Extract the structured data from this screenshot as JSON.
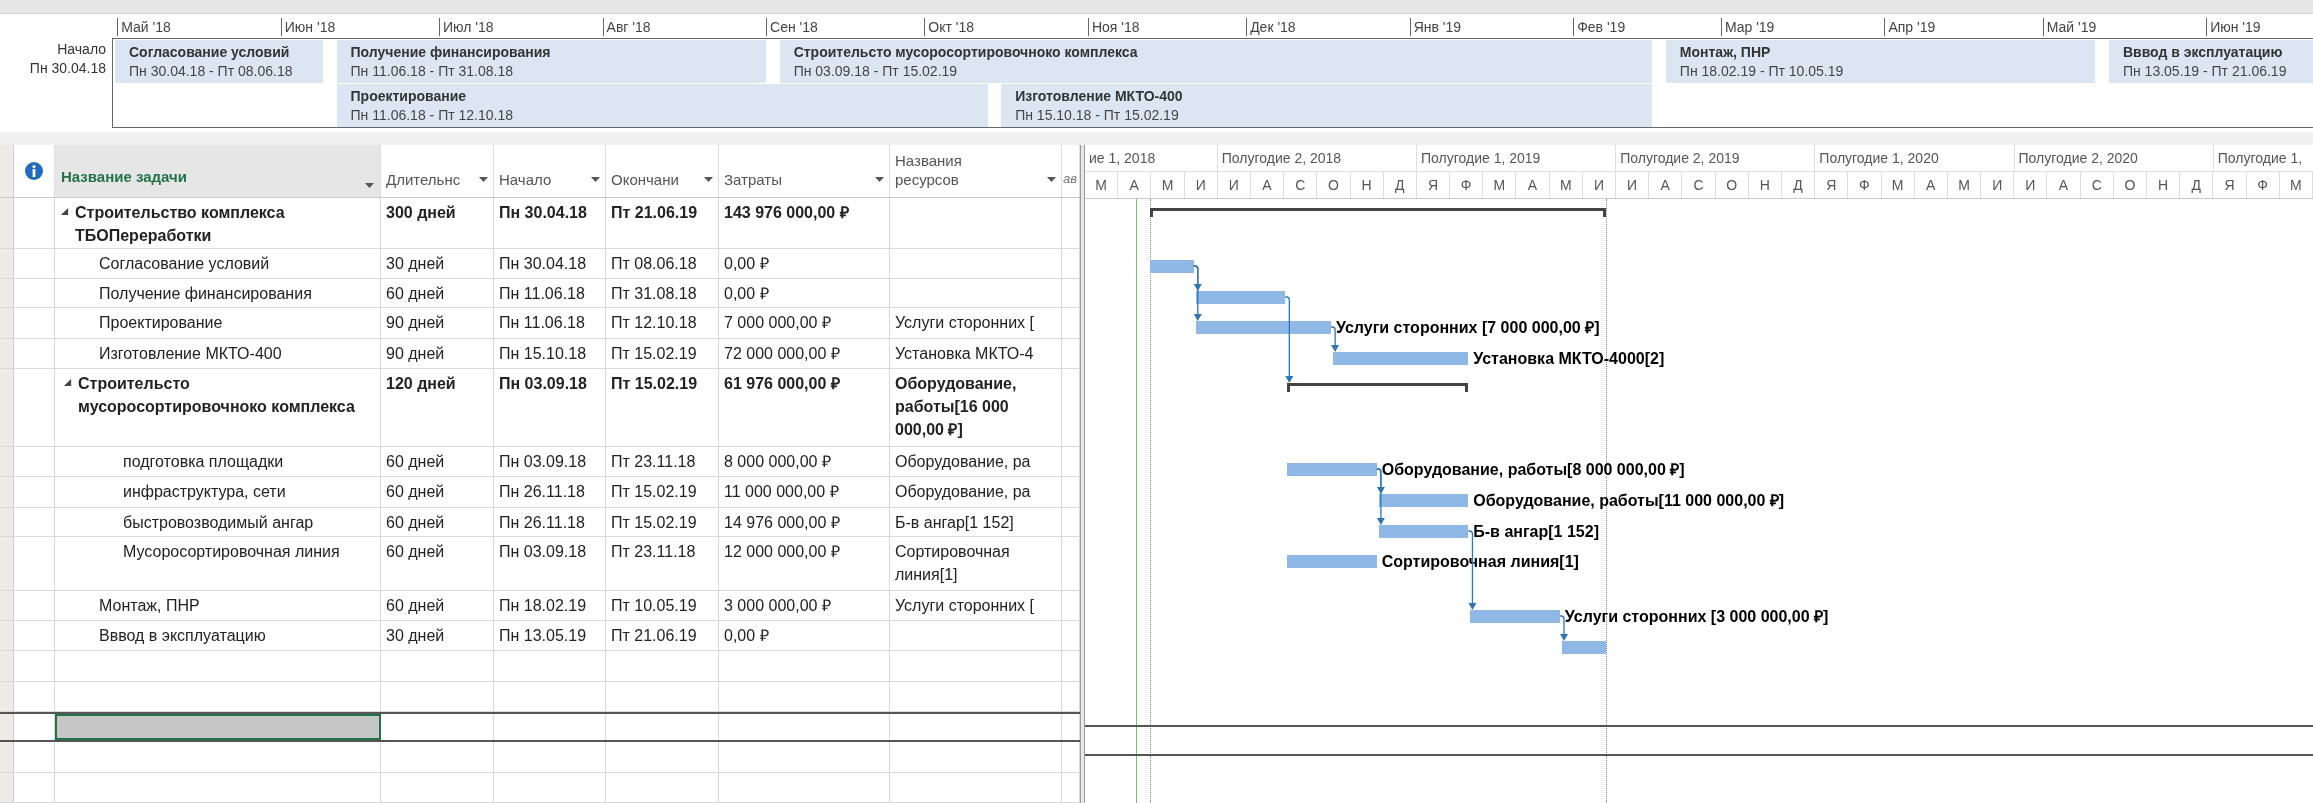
{
  "timeline": {
    "start_label": "Начало",
    "start_date": "Пн 30.04.18",
    "months": [
      "Май '18",
      "Июн '18",
      "Июл '18",
      "Авг '18",
      "Сен '18",
      "Окт '18",
      "Ноя '18",
      "Дек '18",
      "Янв '19",
      "Фев '19",
      "Мар '19",
      "Апр '19",
      "Май '19",
      "Июн '19"
    ],
    "bars": [
      {
        "title": "Согласование условий",
        "dates": "Пн 30.04.18 - Пт 08.06.18"
      },
      {
        "title": "Получение финансирования",
        "dates": "Пн 11.06.18 - Пт 31.08.18"
      },
      {
        "title": "Строительсто мусоросортировочноко комплекса",
        "dates": "Пн 03.09.18 - Пт 15.02.19"
      },
      {
        "title": "Монтаж, ПНР",
        "dates": "Пн 18.02.19 - Пт 10.05.19"
      },
      {
        "title": "Вввод в эксплуатацию",
        "dates": "Пн 13.05.19 - Пт 21.06.19"
      },
      {
        "title": "Проектирование",
        "dates": "Пн 11.06.18 - Пт 12.10.18"
      },
      {
        "title": "Изготовление МКТО-400",
        "dates": "Пн 15.10.18 - Пт 15.02.19"
      }
    ]
  },
  "table": {
    "columns": [
      {
        "label": "Название задачи",
        "kind": "name"
      },
      {
        "label": "Длительнс",
        "kind": "field"
      },
      {
        "label": "Начало",
        "kind": "field"
      },
      {
        "label": "Окончани",
        "kind": "field"
      },
      {
        "label": "Затраты",
        "kind": "field"
      },
      {
        "label": "Названия ресурсов",
        "kind": "field"
      },
      {
        "label": "ав",
        "kind": "partial"
      }
    ],
    "tasks": [
      {
        "kind": "summary",
        "expanded": true,
        "name": "Строительство комплекса ТБОПереработки",
        "duration": "300 дней",
        "start": "Пн 30.04.18",
        "finish": "Пт 21.06.19",
        "cost": "143 976 000,00 ₽",
        "children": [
          {
            "kind": "task",
            "name": "Согласование условий",
            "duration": "30 дней",
            "start": "Пн 30.04.18",
            "finish": "Пт 08.06.18",
            "cost": "0,00 ₽"
          },
          {
            "kind": "task",
            "name": "Получение финансирования",
            "duration": "60 дней",
            "start": "Пн 11.06.18",
            "finish": "Пт 31.08.18",
            "cost": "0,00 ₽"
          },
          {
            "kind": "task",
            "name": "Проектирование",
            "duration": "90 дней",
            "start": "Пн 11.06.18",
            "finish": "Пт 12.10.18",
            "cost": "7 000 000,00 ₽",
            "resources": "Услуги сторонних [",
            "bar_label": "Услуги сторонних [7 000 000,00 ₽]"
          },
          {
            "kind": "task",
            "name": "Изготовление МКТО-400",
            "duration": "90 дней",
            "start": "Пн 15.10.18",
            "finish": "Пт 15.02.19",
            "cost": "72 000 000,00 ₽",
            "resources": "Установка МКТО-4",
            "bar_label": "Установка МКТО-4000[2]"
          },
          {
            "kind": "summary",
            "expanded": true,
            "name": "Строительсто мусоросортировочноко комплекса",
            "duration": "120 дней",
            "start": "Пн 03.09.18",
            "finish": "Пт 15.02.19",
            "cost": "61 976 000,00 ₽",
            "resources": "Оборудование, работы[16 000 000,00 ₽]",
            "children": [
              {
                "kind": "task",
                "name": "подготовка площадки",
                "duration": "60 дней",
                "start": "Пн 03.09.18",
                "finish": "Пт 23.11.18",
                "cost": "8 000 000,00 ₽",
                "resources": "Оборудование, ра",
                "bar_label": "Оборудование, работы[8 000 000,00 ₽]"
              },
              {
                "kind": "task",
                "name": "инфраструктура, сети",
                "duration": "60 дней",
                "start": "Пн 26.11.18",
                "finish": "Пт 15.02.19",
                "cost": "11 000 000,00 ₽",
                "resources": "Оборудование, ра",
                "bar_label": "Оборудование, работы[11 000 000,00 ₽]"
              },
              {
                "kind": "task",
                "name": "быстровозводимый ангар",
                "duration": "60 дней",
                "start": "Пн 26.11.18",
                "finish": "Пт 15.02.19",
                "cost": "14 976 000,00 ₽",
                "resources": "Б-в ангар[1 152]",
                "bar_label": "Б-в ангар[1 152]"
              },
              {
                "kind": "task",
                "name": "Мусоросортировочная линия",
                "duration": "60 дней",
                "start": "Пн 03.09.18",
                "finish": "Пт 23.11.18",
                "cost": "12 000 000,00 ₽",
                "resources": "Сортировочная линия[1]",
                "bar_label": "Сортировочная линия[1]"
              }
            ]
          },
          {
            "kind": "task",
            "name": "Монтаж, ПНР",
            "duration": "60 дней",
            "start": "Пн 18.02.19",
            "finish": "Пт 10.05.19",
            "cost": "3 000 000,00 ₽",
            "resources": "Услуги сторонних [",
            "bar_label": "Услуги сторонних [3 000 000,00 ₽]"
          },
          {
            "kind": "task",
            "name": "Вввод в эксплуатацию",
            "duration": "30 дней",
            "start": "Пн 13.05.19",
            "finish": "Пт 21.06.19",
            "cost": "0,00 ₽"
          }
        ]
      }
    ],
    "blank_rows": [
      {
        "selected": false
      },
      {
        "selected": false
      },
      {
        "selected": true
      },
      {
        "selected": false
      },
      {
        "selected": false
      }
    ]
  },
  "gantt": {
    "half_years": [
      "ие 1, 2018",
      "Полугодие 2, 2018",
      "Полугодие 1, 2019",
      "Полугодие 2, 2019",
      "Полугодие 1, 2020",
      "Полугодие 2, 2020",
      "Полугодие 1,"
    ],
    "months": [
      "М",
      "А",
      "М",
      "И",
      "И",
      "А",
      "С",
      "О",
      "Н",
      "Д",
      "Я",
      "Ф",
      "М",
      "А",
      "М",
      "И",
      "И",
      "А",
      "С",
      "О",
      "Н",
      "Д",
      "Я",
      "Ф",
      "М",
      "А",
      "М",
      "И",
      "И",
      "А",
      "С",
      "О",
      "Н",
      "Д",
      "Я",
      "Ф",
      "М"
    ]
  }
}
